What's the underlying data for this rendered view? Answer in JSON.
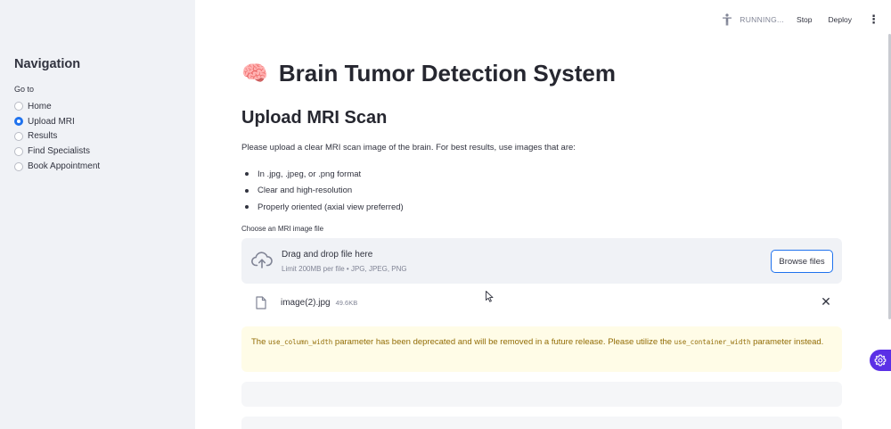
{
  "sidebar": {
    "title": "Navigation",
    "radio_label": "Go to",
    "items": [
      {
        "label": "Home",
        "selected": false
      },
      {
        "label": "Upload MRI",
        "selected": true
      },
      {
        "label": "Results",
        "selected": false
      },
      {
        "label": "Find Specialists",
        "selected": false
      },
      {
        "label": "Book Appointment",
        "selected": false
      }
    ]
  },
  "toolbar": {
    "status": "RUNNING...",
    "stop_label": "Stop",
    "deploy_label": "Deploy",
    "status_icon": "running-person-icon",
    "menu_icon": "kebab-menu-icon"
  },
  "main": {
    "title_emoji": "🧠",
    "title": "Brain Tumor Detection System",
    "section_heading": "Upload MRI Scan",
    "intro": "Please upload a clear MRI scan image of the brain. For best results, use images that are:",
    "requirements": [
      "In .jpg, .jpeg, or .png format",
      "Clear and high-resolution",
      "Properly oriented (axial view preferred)"
    ],
    "uploader": {
      "label": "Choose an MRI image file",
      "drop_text": "Drag and drop file here",
      "limit_text": "Limit 200MB per file • JPG, JPEG, PNG",
      "browse_label": "Browse files",
      "icon": "cloud-upload-icon"
    },
    "uploaded_file": {
      "name": "image(2).jpg",
      "size": "49.6KB",
      "remove_label": "✕",
      "icon": "file-icon"
    },
    "warning": {
      "prefix": "The ",
      "code1": "use_column_width",
      "middle": " parameter has been deprecated and will be removed in a future release. Please utilize the ",
      "code2": "use_container_width",
      "suffix": " parameter instead."
    }
  },
  "colors": {
    "accent": "#1f72ee",
    "sidebar_bg": "#f0f2f6",
    "warning_bg": "#fffce7",
    "warning_text": "#926c05",
    "fab": "#5b30e6"
  }
}
